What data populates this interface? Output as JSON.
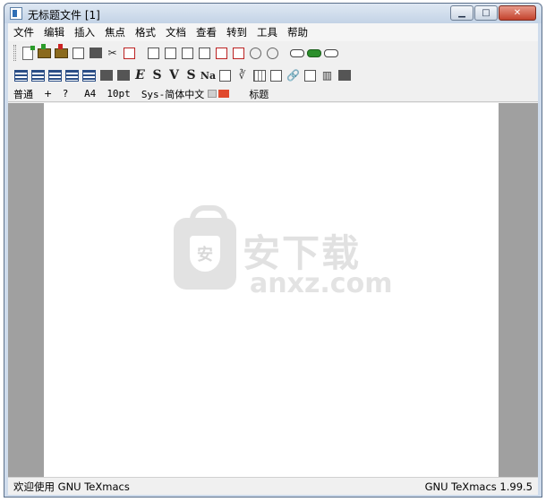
{
  "window": {
    "title": "无标题文件 [1]",
    "minimize_label": "▁",
    "maximize_label": "□",
    "close_label": "✕"
  },
  "menu": [
    "文件",
    "编辑",
    "插入",
    "焦点",
    "格式",
    "文档",
    "查看",
    "转到",
    "工具",
    "帮助"
  ],
  "format_bar": {
    "style_mode": "普通",
    "plus": "+",
    "help": "?",
    "paper": "A4",
    "font_size": "10pt",
    "font": "Sys-简体中文",
    "section": "标题"
  },
  "toolbar2_glyphs": {
    "emphasize": "E",
    "strong": "S",
    "verbatim": "V",
    "sans": "S",
    "name": "Na"
  },
  "watermark": {
    "badge": "安",
    "title": "安下载",
    "subtitle": "anxz.com"
  },
  "status": {
    "left": "欢迎使用 GNU TeXmacs",
    "right": "GNU TeXmacs 1.99.5"
  }
}
